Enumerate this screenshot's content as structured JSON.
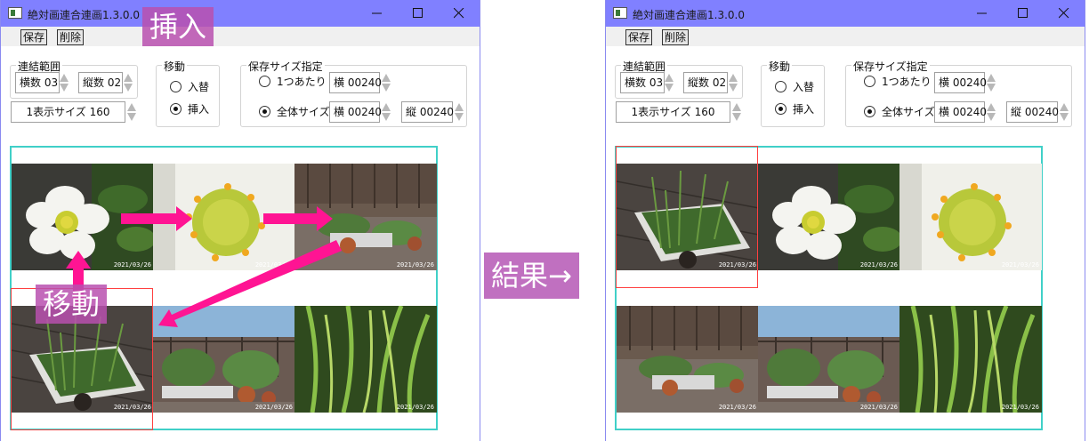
{
  "window": {
    "title": "絶対画連合連画1.3.0.0",
    "minimize_icon": "minimize-icon",
    "maximize_icon": "maximize-icon",
    "close_icon": "close-icon"
  },
  "menu": {
    "save": "保存",
    "delete": "削除"
  },
  "layout_group": {
    "legend": "連結範囲",
    "horizontal": "横数 03",
    "vertical": "縦数 02",
    "display_size": "1表示サイズ 160"
  },
  "move_group": {
    "legend": "移動",
    "options": [
      {
        "label": "入替",
        "checked": false
      },
      {
        "label": "挿入",
        "checked": true
      }
    ]
  },
  "save_group": {
    "legend": "保存サイズ指定",
    "per_one": {
      "label": "1つあたり",
      "checked": false,
      "width": "横 00240"
    },
    "overall": {
      "label": "全体サイズ",
      "checked": true,
      "width": "横 00240",
      "height": "縦 00240"
    }
  },
  "stamp_text": "2021/03/26",
  "before_cells": [
    "flower-closeup",
    "flower-macro",
    "patio-pots",
    "garlic-tray",
    "pots-fence",
    "garlic-leaves"
  ],
  "after_cells": [
    "garlic-tray",
    "flower-closeup",
    "flower-macro",
    "patio-pots",
    "pots-fence",
    "garlic-leaves"
  ],
  "annotations": {
    "insert_label": "挿入",
    "move_label": "移動",
    "result_label": "結果→"
  },
  "colors": {
    "titlebar": "#8080ff",
    "grid_border": "#40d0c8",
    "selection": "#ff4040",
    "arrow": "#ff1493",
    "label_bg": "#b950af"
  }
}
